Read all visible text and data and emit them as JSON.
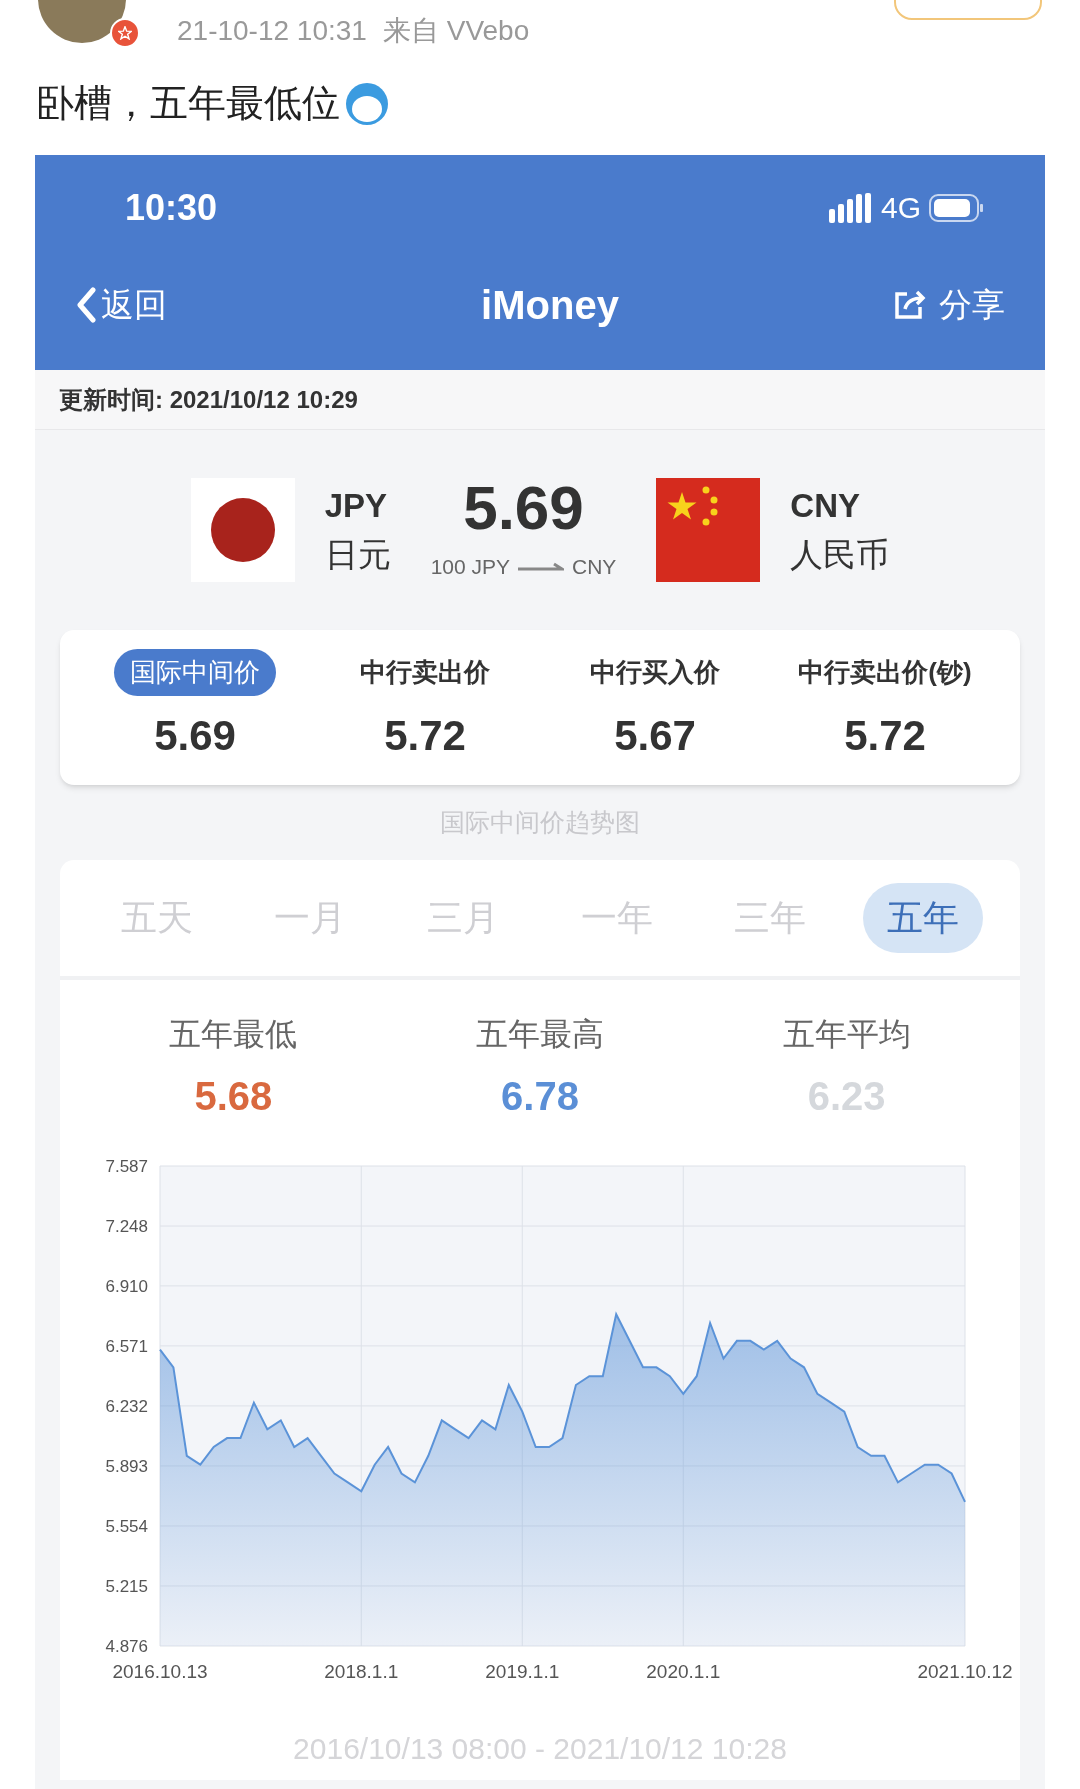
{
  "post": {
    "timestamp": "21-10-12 10:31",
    "source": "来自 VVebo",
    "text": "卧槽，五年最低位"
  },
  "status_bar": {
    "time": "10:30",
    "network": "4G"
  },
  "nav": {
    "back": "返回",
    "title": "iMoney",
    "share": "分享"
  },
  "update_time": "更新时间: 2021/10/12 10:29",
  "pair": {
    "from": {
      "code": "JPY",
      "name": "日元"
    },
    "rate": "5.69",
    "note_from": "100 JPY",
    "note_to": "CNY",
    "to": {
      "code": "CNY",
      "name": "人民币"
    }
  },
  "rates": [
    {
      "label": "国际中间价",
      "value": "5.69",
      "selected": true
    },
    {
      "label": "中行卖出价",
      "value": "5.72",
      "selected": false
    },
    {
      "label": "中行买入价",
      "value": "5.67",
      "selected": false
    },
    {
      "label": "中行卖出价(钞)",
      "value": "5.72",
      "selected": false
    }
  ],
  "chart_title": "国际中间价趋势图",
  "periods": [
    {
      "label": "五天",
      "selected": false
    },
    {
      "label": "一月",
      "selected": false
    },
    {
      "label": "三月",
      "selected": false
    },
    {
      "label": "一年",
      "selected": false
    },
    {
      "label": "三年",
      "selected": false
    },
    {
      "label": "五年",
      "selected": true
    }
  ],
  "stats": [
    {
      "label": "五年最低",
      "value": "5.68",
      "color": "#d9693f"
    },
    {
      "label": "五年最高",
      "value": "6.78",
      "color": "#5b8fd6"
    },
    {
      "label": "五年平均",
      "value": "6.23",
      "color": "#d5d8dc"
    }
  ],
  "chart_data": {
    "type": "area",
    "grid": true,
    "ylim": [
      4.876,
      7.587
    ],
    "categories": [
      "2016.10.13",
      null,
      null,
      null,
      null,
      null,
      null,
      null,
      null,
      null,
      null,
      null,
      null,
      null,
      null,
      "2018.1.1",
      null,
      null,
      null,
      null,
      null,
      null,
      null,
      null,
      null,
      null,
      null,
      "2019.1.1",
      null,
      null,
      null,
      null,
      null,
      null,
      null,
      null,
      null,
      null,
      null,
      "2020.1.1",
      null,
      null,
      null,
      null,
      null,
      null,
      null,
      null,
      null,
      null,
      null,
      null,
      null,
      null,
      null,
      null,
      null,
      null,
      null,
      null,
      "2021.10.12"
    ],
    "yticks": [
      4.876,
      5.215,
      5.554,
      5.893,
      6.232,
      6.571,
      {
        "value": 6.91,
        "label": "6.910"
      },
      7.248,
      7.587
    ],
    "series": [
      {
        "color": "#5b93d8",
        "values": [
          6.55,
          6.45,
          5.95,
          5.9,
          6.0,
          6.05,
          6.05,
          6.25,
          6.1,
          6.15,
          6.0,
          6.05,
          5.95,
          5.85,
          5.8,
          5.75,
          5.9,
          6.0,
          5.85,
          5.8,
          5.95,
          6.15,
          6.1,
          6.05,
          6.15,
          6.1,
          6.35,
          6.2,
          6.0,
          6.0,
          6.05,
          6.35,
          6.4,
          6.4,
          6.75,
          6.6,
          6.45,
          6.45,
          6.4,
          6.3,
          6.4,
          6.7,
          6.5,
          6.6,
          6.6,
          6.55,
          6.6,
          6.5,
          6.45,
          6.3,
          6.25,
          6.2,
          6.0,
          5.95,
          5.95,
          5.8,
          5.85,
          5.9,
          5.9,
          5.85,
          5.69
        ]
      }
    ]
  },
  "range": "2016/10/13 08:00 - 2021/10/12 10:28"
}
